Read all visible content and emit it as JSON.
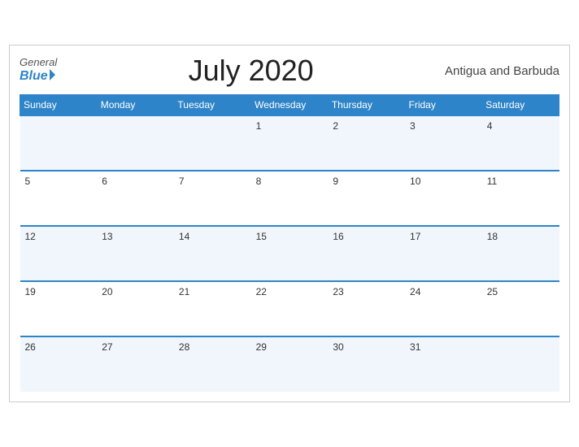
{
  "header": {
    "title": "July 2020",
    "country": "Antigua and Barbuda",
    "logo_general": "General",
    "logo_blue": "Blue"
  },
  "weekdays": [
    "Sunday",
    "Monday",
    "Tuesday",
    "Wednesday",
    "Thursday",
    "Friday",
    "Saturday"
  ],
  "weeks": [
    [
      null,
      null,
      null,
      1,
      2,
      3,
      4
    ],
    [
      5,
      6,
      7,
      8,
      9,
      10,
      11
    ],
    [
      12,
      13,
      14,
      15,
      16,
      17,
      18
    ],
    [
      19,
      20,
      21,
      22,
      23,
      24,
      25
    ],
    [
      26,
      27,
      28,
      29,
      30,
      31,
      null
    ]
  ],
  "colors": {
    "header_bg": "#2e84c8",
    "row_odd": "#f0f6fc",
    "row_even": "#ffffff",
    "border": "#2e84c8"
  }
}
